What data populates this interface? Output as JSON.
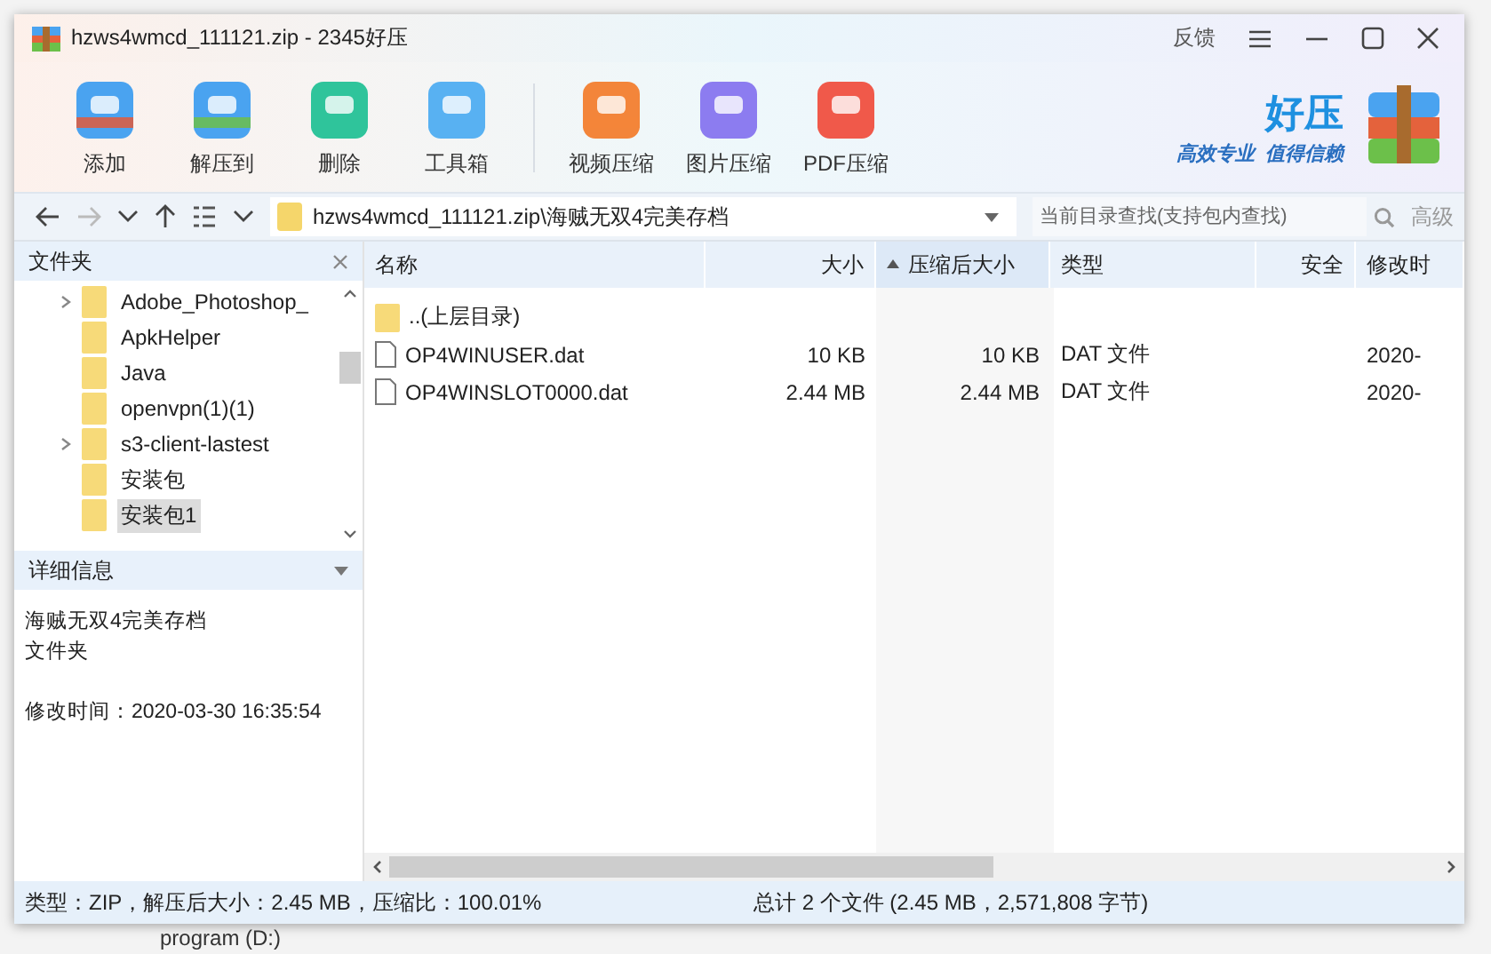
{
  "window": {
    "title": "hzws4wmcd_111121.zip - 2345好压",
    "feedback": "反馈"
  },
  "toolbar": [
    {
      "label": "添加"
    },
    {
      "label": "解压到"
    },
    {
      "label": "删除"
    },
    {
      "label": "工具箱"
    },
    {
      "label": "视频压缩"
    },
    {
      "label": "图片压缩"
    },
    {
      "label": "PDF压缩"
    }
  ],
  "logo": {
    "name": "好压",
    "slogan_1": "高效专业",
    "slogan_2": "值得信赖"
  },
  "address": {
    "path": "hzws4wmcd_111121.zip\\海贼无双4完美存档"
  },
  "search": {
    "placeholder": "当前目录查找(支持包内查找)",
    "advanced": "高级"
  },
  "sidebar": {
    "title": "文件夹",
    "items": [
      {
        "label": "Adobe_Photoshop_",
        "expandable": true,
        "selected": false
      },
      {
        "label": "ApkHelper",
        "expandable": false,
        "selected": false
      },
      {
        "label": "Java",
        "expandable": false,
        "selected": false
      },
      {
        "label": "openvpn(1)(1)",
        "expandable": false,
        "selected": false
      },
      {
        "label": "s3-client-lastest",
        "expandable": true,
        "selected": false
      },
      {
        "label": "安装包",
        "expandable": false,
        "selected": false
      },
      {
        "label": "安装包1",
        "expandable": false,
        "selected": true
      }
    ]
  },
  "details": {
    "title": "详细信息",
    "name": "海贼无双4完美存档",
    "type": "文件夹",
    "modified": "修改时间：2020-03-30 16:35:54"
  },
  "table": {
    "columns": [
      {
        "label": "名称",
        "sorted": false
      },
      {
        "label": "大小",
        "sorted": false
      },
      {
        "label": "压缩后大小",
        "sorted": true
      },
      {
        "label": "类型",
        "sorted": false
      },
      {
        "label": "安全",
        "sorted": false
      },
      {
        "label": "修改时",
        "sorted": false
      }
    ],
    "rows": [
      {
        "kind": "folder",
        "cells": [
          "..(上层目录)",
          "",
          "",
          "",
          "",
          ""
        ]
      },
      {
        "kind": "file",
        "cells": [
          "OP4WINUSER.dat",
          "10 KB",
          "10 KB",
          "DAT 文件",
          "",
          "2020-"
        ]
      },
      {
        "kind": "file",
        "cells": [
          "OP4WINSLOT0000.dat",
          "2.44 MB",
          "2.44 MB",
          "DAT 文件",
          "",
          "2020-"
        ]
      }
    ]
  },
  "status_bar": {
    "left": "类型：ZIP，解压后大小：2.45 MB，压缩比：100.01%",
    "right": "总计 2 个文件 (2.45 MB，2,571,808 字节)"
  },
  "desktop": {
    "drive": "program (D:)"
  }
}
